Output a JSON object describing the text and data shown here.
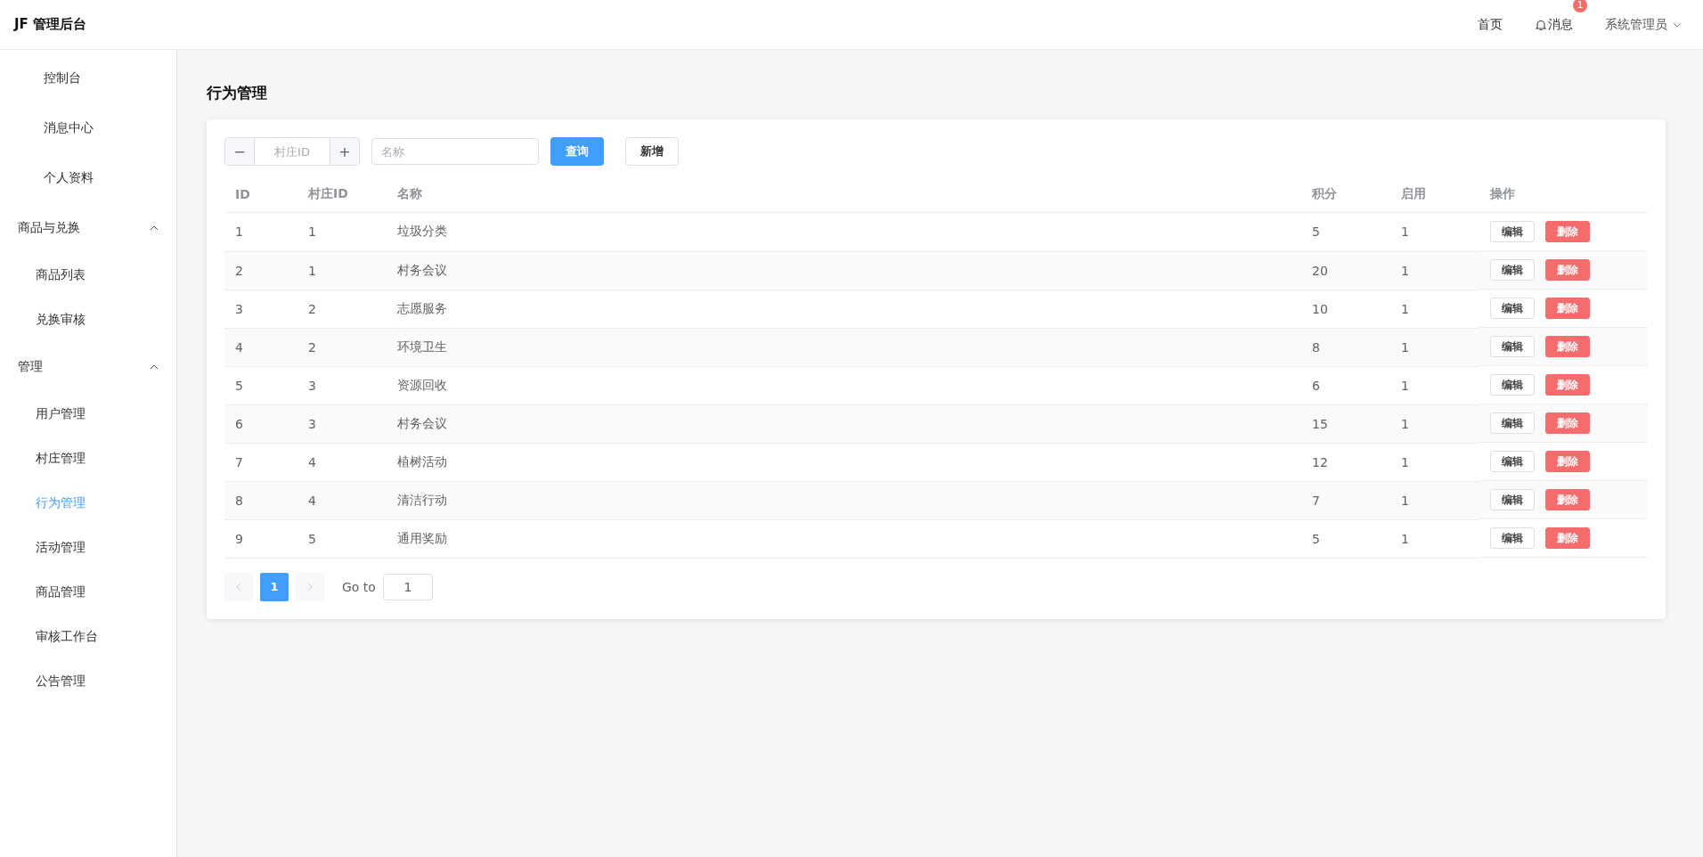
{
  "header": {
    "logo": "JF 管理后台",
    "nav": [
      {
        "label": "首页",
        "kind": "link"
      },
      {
        "label": "消息",
        "kind": "bell",
        "badge": "1"
      }
    ],
    "user": {
      "name": "系统管理员"
    }
  },
  "sidebar": {
    "items": [
      {
        "kind": "item",
        "label": "控制台",
        "selected": false
      },
      {
        "kind": "item",
        "label": "消息中心",
        "selected": false
      },
      {
        "kind": "item",
        "label": "个人资料",
        "selected": false
      },
      {
        "kind": "group",
        "label": "商品与兑换",
        "expanded": true,
        "children": [
          {
            "label": "商品列表",
            "selected": false
          },
          {
            "label": "兑换审核",
            "selected": false
          }
        ]
      },
      {
        "kind": "group",
        "label": "管理",
        "expanded": true,
        "children": [
          {
            "label": "用户管理",
            "selected": false
          },
          {
            "label": "村庄管理",
            "selected": false
          },
          {
            "label": "行为管理",
            "selected": true
          },
          {
            "label": "活动管理",
            "selected": false
          },
          {
            "label": "商品管理",
            "selected": false
          },
          {
            "label": "审核工作台",
            "selected": false
          },
          {
            "label": "公告管理",
            "selected": false
          }
        ]
      }
    ]
  },
  "page_title": "行为管理",
  "filters": {
    "village_id": {
      "placeholder": "村庄ID",
      "minus": "−",
      "plus": "+"
    },
    "name": {
      "placeholder": "名称"
    },
    "buttons": [
      {
        "label": "查询",
        "kind": "primary"
      },
      {
        "label": "新增",
        "kind": "default"
      }
    ]
  },
  "table": {
    "columns": [
      "ID",
      "村庄ID",
      "名称",
      "积分",
      "启用",
      "操作"
    ],
    "rows": [
      {
        "cells": [
          "1",
          "1",
          "垃圾分类",
          "5",
          "1"
        ],
        "actions": [
          {
            "label": "编辑",
            "kind": "default"
          },
          {
            "label": "删除",
            "kind": "danger"
          }
        ]
      },
      {
        "cells": [
          "2",
          "1",
          "村务会议",
          "20",
          "1"
        ],
        "actions": [
          {
            "label": "编辑",
            "kind": "default"
          },
          {
            "label": "删除",
            "kind": "danger"
          }
        ]
      },
      {
        "cells": [
          "3",
          "2",
          "志愿服务",
          "10",
          "1"
        ],
        "actions": [
          {
            "label": "编辑",
            "kind": "default"
          },
          {
            "label": "删除",
            "kind": "danger"
          }
        ]
      },
      {
        "cells": [
          "4",
          "2",
          "环境卫生",
          "8",
          "1"
        ],
        "actions": [
          {
            "label": "编辑",
            "kind": "default"
          },
          {
            "label": "删除",
            "kind": "danger"
          }
        ]
      },
      {
        "cells": [
          "5",
          "3",
          "资源回收",
          "6",
          "1"
        ],
        "actions": [
          {
            "label": "编辑",
            "kind": "default"
          },
          {
            "label": "删除",
            "kind": "danger"
          }
        ]
      },
      {
        "cells": [
          "6",
          "3",
          "村务会议",
          "15",
          "1"
        ],
        "actions": [
          {
            "label": "编辑",
            "kind": "default"
          },
          {
            "label": "删除",
            "kind": "danger"
          }
        ]
      },
      {
        "cells": [
          "7",
          "4",
          "植树活动",
          "12",
          "1"
        ],
        "actions": [
          {
            "label": "编辑",
            "kind": "default"
          },
          {
            "label": "删除",
            "kind": "danger"
          }
        ]
      },
      {
        "cells": [
          "8",
          "4",
          "清洁行动",
          "7",
          "1"
        ],
        "actions": [
          {
            "label": "编辑",
            "kind": "default"
          },
          {
            "label": "删除",
            "kind": "danger"
          }
        ]
      },
      {
        "cells": [
          "9",
          "5",
          "通用奖励",
          "5",
          "1"
        ],
        "actions": [
          {
            "label": "编辑",
            "kind": "default"
          },
          {
            "label": "删除",
            "kind": "danger"
          }
        ]
      }
    ]
  },
  "pagination": {
    "prev_disabled": true,
    "next_disabled": true,
    "pages": [
      {
        "label": "1",
        "selected": true
      }
    ],
    "goto_label": "Go to",
    "goto_value": "1"
  }
}
